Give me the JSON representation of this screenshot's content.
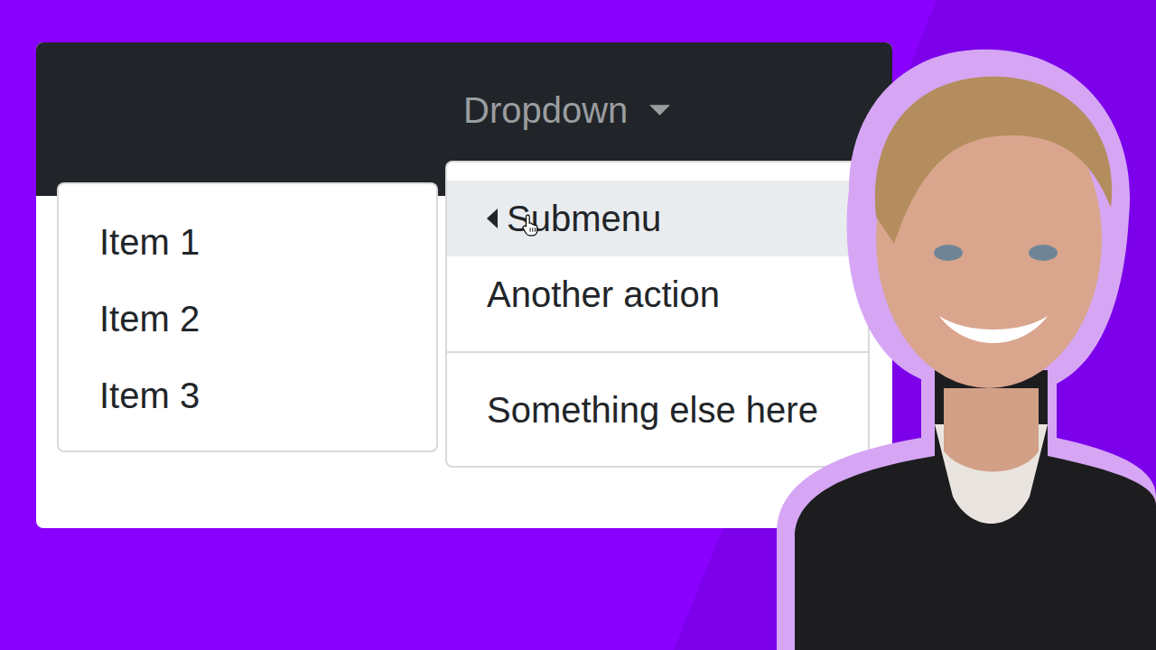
{
  "navbar": {
    "dropdown": {
      "label": "Dropdown",
      "expanded": true
    }
  },
  "menu": {
    "items": [
      {
        "kind": "submenu",
        "label": "Submenu",
        "selected": true,
        "expanded": true
      },
      {
        "kind": "item",
        "label": "Another action",
        "selected": false
      },
      {
        "kind": "divider",
        "selected": false
      },
      {
        "kind": "item",
        "label": "Something else here",
        "selected": false
      }
    ]
  },
  "submenu": {
    "items": [
      {
        "label": "Item 1",
        "selected": false
      },
      {
        "label": "Item 2",
        "selected": false
      },
      {
        "label": "Item 3",
        "selected": false
      }
    ]
  }
}
